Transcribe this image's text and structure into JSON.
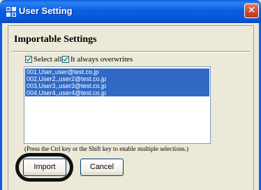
{
  "window": {
    "title": "User Setting",
    "close_glyph": "✕"
  },
  "section": {
    "heading": "Importable Settings"
  },
  "options": {
    "select_all": {
      "label": "Select all",
      "checked": true
    },
    "always_overwrite": {
      "label": "It always overwrites",
      "checked": true
    }
  },
  "users": {
    "items": [
      {
        "label": "001,User,,user@test.co.jp",
        "selected": true
      },
      {
        "label": "002,User2,,user2@test.co.jp",
        "selected": true
      },
      {
        "label": "003,User3,,user3@test.co.jp",
        "selected": true
      },
      {
        "label": "004,User4,,user4@test.co.jp",
        "selected": true
      }
    ]
  },
  "hint": "(Press the Ctrl key or the Shift key to enable multiple selections.)",
  "buttons": {
    "import_label": "Import",
    "cancel_label": "Cancel"
  },
  "colors": {
    "titlebar": "#0b5fe0",
    "selection": "#316ac5",
    "dialog_bg": "#ece9d8"
  }
}
